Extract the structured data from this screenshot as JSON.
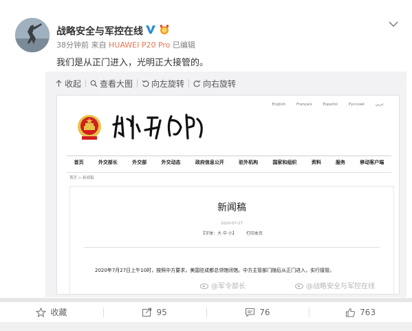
{
  "post": {
    "username": "战略安全与军控在线",
    "time": "38分钟前",
    "from_prefix": "来自",
    "source_device": "HUAWEI P20 Pro",
    "edited": "已编辑",
    "text": "我们是从正门进入，光明正大接管的。"
  },
  "media_toolbar": {
    "collapse": "收起",
    "view_large": "查看大图",
    "rotate_left": "向左旋转",
    "rotate_right": "向右旋转"
  },
  "embedded_page": {
    "languages": [
      "English",
      "Français",
      "Español",
      "Русский",
      "عربي"
    ],
    "nav_items": [
      "首页",
      "外交部长",
      "外交部",
      "外交动态",
      "政府信息公开",
      "驻外机构",
      "国家和组织",
      "资料",
      "服务",
      "移动客户端"
    ],
    "breadcrumb": "首页 > 新闻稿",
    "article_title": "新闻稿",
    "article_date": "2020-07-27",
    "font_size_control": "【字体：大 中 小】",
    "print_link": "打印本页",
    "article_body": "2020年7月27日上午10时，按照中方要求，美国驻成都总领馆闭馆。中方主管部门随后从正门进入，实行接管。",
    "watermark_1": "@军令部长",
    "watermark_2": "@战略安全与军控在线"
  },
  "actions": {
    "favorite_label": "收藏",
    "repost_count": "95",
    "comment_count": "76",
    "like_count": "763"
  },
  "colors": {
    "source_link": "#eb7350",
    "verified_badge": "#2a8ed8",
    "medal": "#f0a020",
    "emblem_red": "#d11f1f",
    "emblem_gold": "#e8c24a"
  },
  "icons": {
    "verified": "verified-v-icon",
    "medal": "medal-icon",
    "collapse_chevron": "chevron-down-icon",
    "favorite": "star-icon",
    "repost": "repost-icon",
    "comment": "comment-icon",
    "like": "thumbs-up-icon"
  }
}
